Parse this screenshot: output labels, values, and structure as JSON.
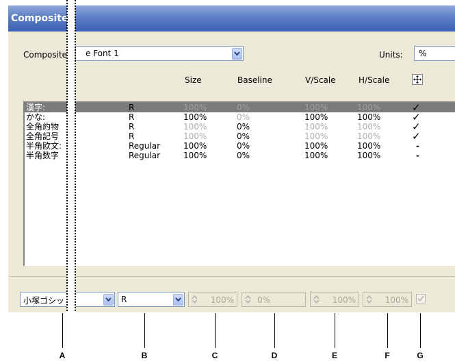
{
  "window": {
    "title": "Composite"
  },
  "composite_font": {
    "label": "Composite:",
    "value": "e Font 1"
  },
  "units": {
    "label": "Units:",
    "value": "%"
  },
  "columns": [
    "Size",
    "Baseline",
    "V/Scale",
    "H/Scale"
  ],
  "rows": [
    {
      "name": "漢字:",
      "font": "R",
      "size": "100%",
      "baseline": "0%",
      "vscale": "100%",
      "hscale": "100%",
      "mark": "✓"
    },
    {
      "name": "かな:",
      "font": "R",
      "size": "100%",
      "baseline": "0%",
      "vscale": "100%",
      "hscale": "100%",
      "mark": "✓"
    },
    {
      "name": "全角約物",
      "font": "R",
      "size": "100%",
      "baseline": "0%",
      "vscale": "100%",
      "hscale": "100%",
      "mark": "✓"
    },
    {
      "name": "全角記号",
      "font": "R",
      "size": "100%",
      "baseline": "0%",
      "vscale": "100%",
      "hscale": "100%",
      "mark": "✓"
    },
    {
      "name": "半角欧文:",
      "font": "Regular",
      "size": "100%",
      "baseline": "0%",
      "vscale": "100%",
      "hscale": "100%",
      "mark": "-"
    },
    {
      "name": "半角数字",
      "font": "Regular",
      "size": "100%",
      "baseline": "0%",
      "vscale": "100%",
      "hscale": "100%",
      "mark": "-"
    }
  ],
  "controls": {
    "font_family": "小塚ゴシッ",
    "font_style": "R",
    "size": "100%",
    "baseline": "0%",
    "vscale": "100%",
    "hscale": "100%"
  },
  "callouts": [
    "A",
    "B",
    "C",
    "D",
    "E",
    "F",
    "G"
  ]
}
